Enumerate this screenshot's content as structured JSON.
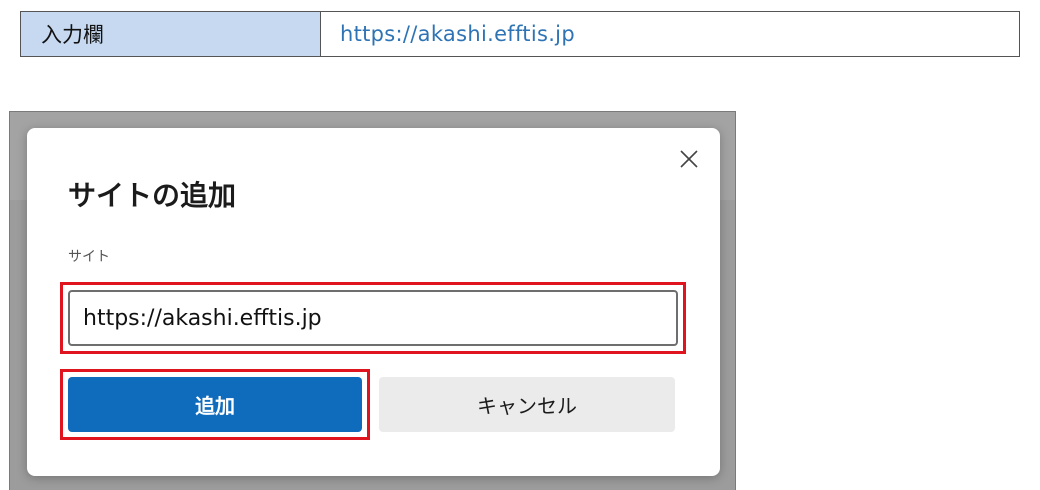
{
  "info_table": {
    "label": "入力欄",
    "value": "https://akashi.efftis.jp"
  },
  "dialog": {
    "title": "サイトの追加",
    "close_icon": "close-icon",
    "field_label": "サイト",
    "site_input": {
      "value": "https://akashi.efftis.jp"
    },
    "add_button": "追加",
    "cancel_button": "キャンセル"
  },
  "colors": {
    "label_bg": "#c6d9f1",
    "link_text": "#2e74b5",
    "primary_button": "#0f6cbd",
    "secondary_button": "#ebebeb",
    "highlight": "#e0141e"
  }
}
